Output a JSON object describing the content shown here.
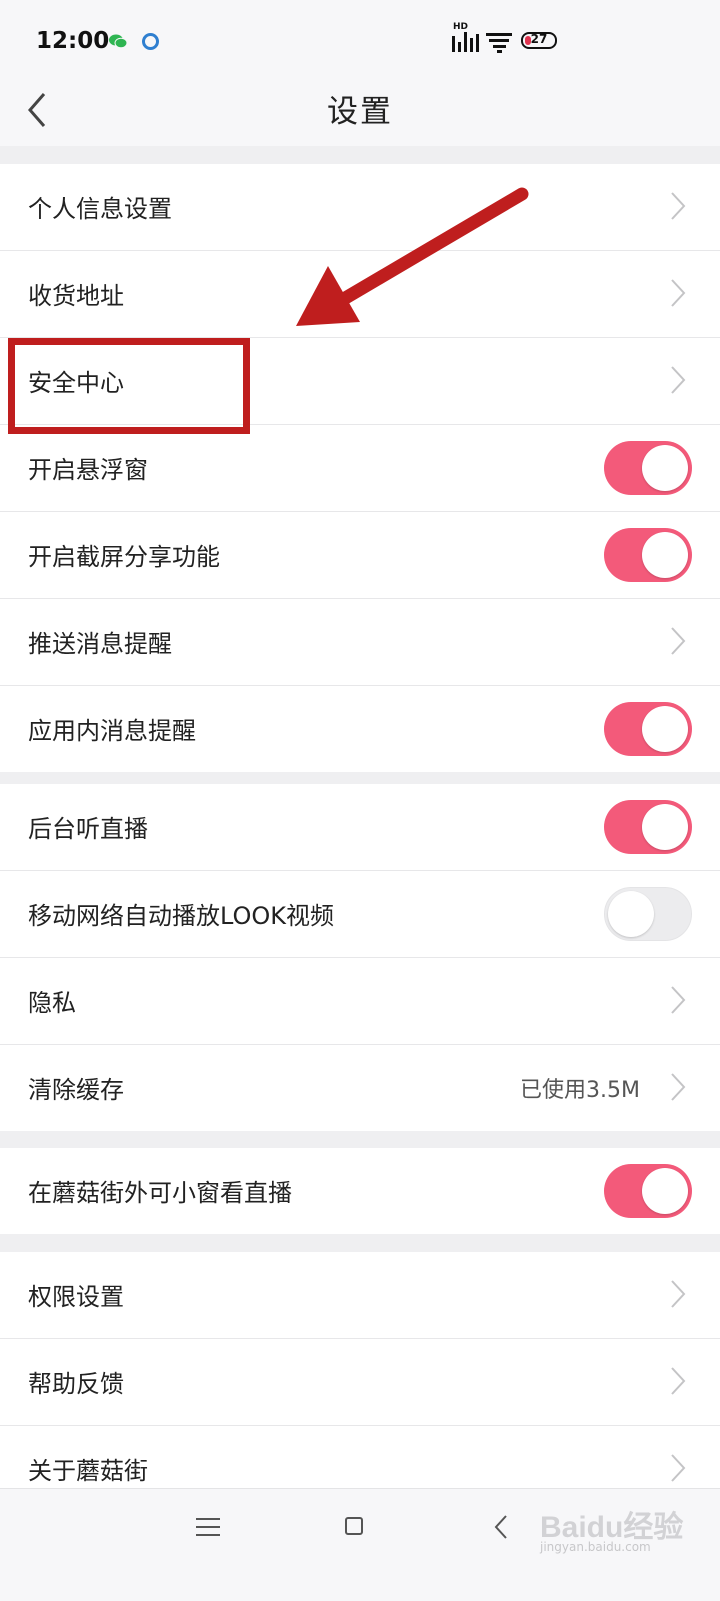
{
  "status_bar": {
    "time": "12:00",
    "network_label": "HD",
    "battery_level": "27"
  },
  "header": {
    "title": "设置"
  },
  "groups": [
    {
      "rows": [
        {
          "label": "个人信息设置",
          "control": "chevron"
        },
        {
          "label": "收货地址",
          "control": "chevron"
        },
        {
          "label": "安全中心",
          "control": "chevron"
        },
        {
          "label": "开启悬浮窗",
          "control": "toggle",
          "on": true
        },
        {
          "label": "开启截屏分享功能",
          "control": "toggle",
          "on": true
        },
        {
          "label": "推送消息提醒",
          "control": "chevron"
        },
        {
          "label": "应用内消息提醒",
          "control": "toggle",
          "on": true
        }
      ]
    },
    {
      "rows": [
        {
          "label": "后台听直播",
          "control": "toggle",
          "on": true
        },
        {
          "label": "移动网络自动播放LOOK视频",
          "control": "toggle",
          "on": false
        },
        {
          "label": "隐私",
          "control": "chevron"
        },
        {
          "label": "清除缓存",
          "value": "已使用3.5M",
          "control": "chevron"
        }
      ]
    },
    {
      "rows": [
        {
          "label": "在蘑菇街外可小窗看直播",
          "control": "toggle",
          "on": true
        }
      ]
    },
    {
      "rows": [
        {
          "label": "权限设置",
          "control": "chevron"
        },
        {
          "label": "帮助反馈",
          "control": "chevron"
        },
        {
          "label": "关于蘑菇街",
          "control": "chevron"
        }
      ]
    }
  ],
  "watermark": {
    "brand": "Baidu经验",
    "url": "jingyan.baidu.com"
  },
  "colors": {
    "toggle_on": "#f35a7a",
    "annotation_red": "#bf1e1e"
  }
}
